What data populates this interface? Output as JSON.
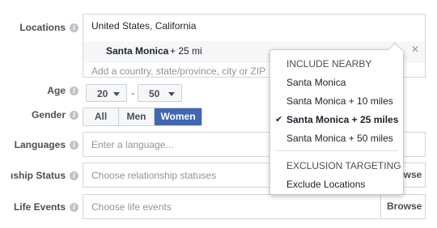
{
  "locations": {
    "label": "Locations",
    "country": "United States, California",
    "selected_name": "Santa Monica",
    "selected_radius": "+ 25 mi",
    "input_placeholder": "Add a country, state/province, city or ZIP"
  },
  "age": {
    "label": "Age",
    "min": "20",
    "dash": "-",
    "max": "50"
  },
  "gender": {
    "label": "Gender",
    "options": [
      "All",
      "Men",
      "Women"
    ],
    "selected": "Women"
  },
  "languages": {
    "label": "Languages",
    "placeholder": "Enter a language..."
  },
  "relationship": {
    "label": "ıship Status",
    "placeholder": "Choose relationship statuses",
    "browse": "Browse"
  },
  "life_events": {
    "label": "Life Events",
    "placeholder": "Choose life events",
    "browse": "Browse"
  },
  "dropdown": {
    "include_header": "INCLUDE NEARBY",
    "items": [
      "Santa Monica",
      "Santa Monica + 10 miles",
      "Santa Monica + 25 miles",
      "Santa Monica + 50 miles"
    ],
    "selected_index": 2,
    "exclusion_header": "EXCLUSION TARGETING",
    "exclude_item": "Exclude Locations"
  },
  "colors": {
    "accent": "#4267b2",
    "border": "#d3d6db",
    "placeholder": "#90949c"
  },
  "icons": {
    "info": "info-icon",
    "chevron": "chevron-down-icon",
    "remove": "close-icon",
    "check": "check-icon"
  }
}
